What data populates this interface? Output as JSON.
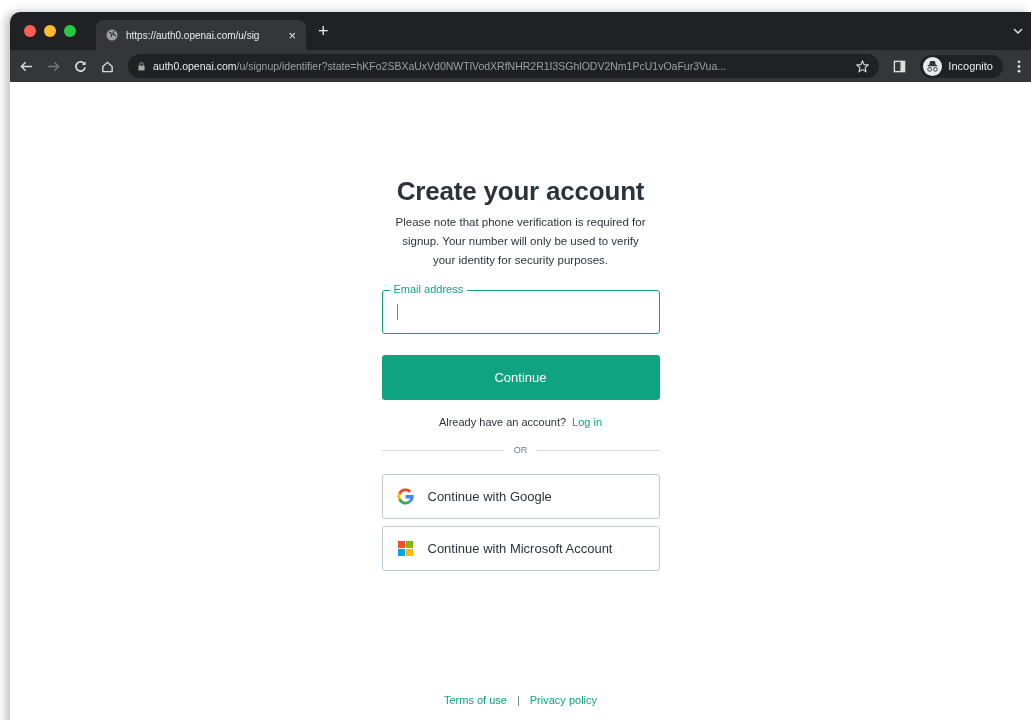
{
  "tab": {
    "title": "https://auth0.openai.com/u/sig",
    "close": "×",
    "new_tab": "+"
  },
  "address_bar": {
    "host": "auth0.openai.com",
    "path": "/u/signup/identifier?state=hKFo2SBXaUxVd0NWTlVodXRfNHR2R1I3SGhlODV2Nm1PcU1vOaFur3Vua..."
  },
  "profile": {
    "label": "Incognito"
  },
  "form": {
    "title": "Create your account",
    "note": "Please note that phone verification is required for signup. Your number will only be used to verify your identity for security purposes.",
    "email_field": {
      "label": "Email address",
      "focused": true
    },
    "continue_button": "Continue",
    "login_prompt": "Already have an account?",
    "login_link": "Log in",
    "divider": "OR",
    "providers": [
      {
        "kind": "google",
        "label": "Continue with Google"
      },
      {
        "kind": "microsoft",
        "label": "Continue with Microsoft Account"
      }
    ]
  },
  "footer": {
    "links": [
      "Terms of use",
      "Privacy policy"
    ],
    "separator": "|"
  }
}
